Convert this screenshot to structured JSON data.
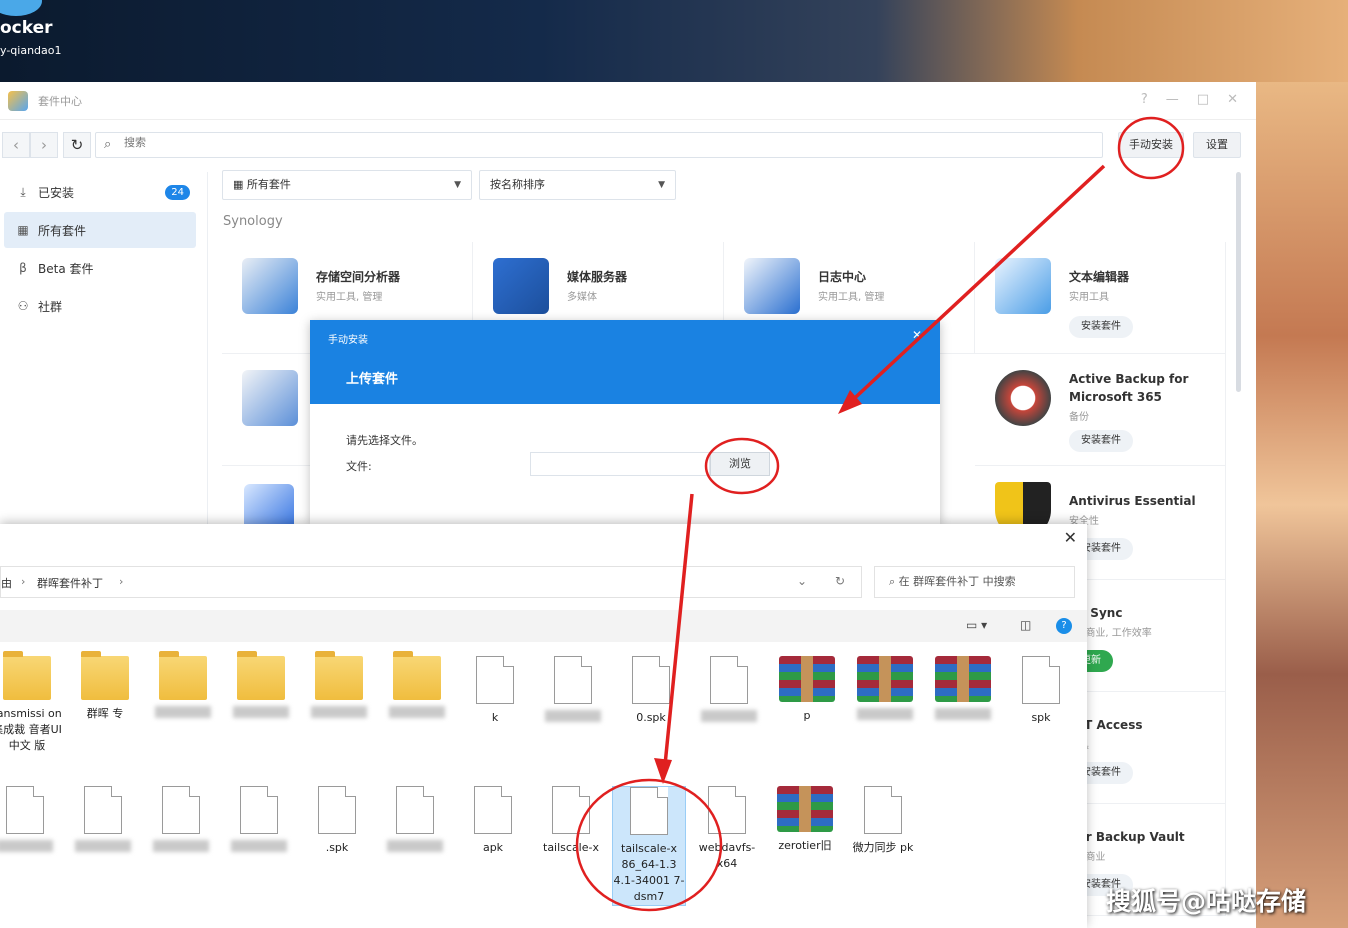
{
  "desktop": {
    "dock_label": "ocker",
    "user": "y-qiandao1"
  },
  "window": {
    "title": "套件中心",
    "controls": [
      "?",
      "—",
      "□",
      "✕"
    ]
  },
  "toolbar": {
    "search_placeholder": "搜索",
    "manual_install": "手动安装",
    "settings": "设置"
  },
  "sidebar": {
    "items": [
      {
        "label": "已安装",
        "icon": "download-icon",
        "badge": "24"
      },
      {
        "label": "所有套件",
        "icon": "grid-icon"
      },
      {
        "label": "Beta 套件",
        "icon": "beta-icon"
      },
      {
        "label": "社群",
        "icon": "community-icon"
      }
    ]
  },
  "filters": {
    "category": "所有套件",
    "sort": "按名称排序"
  },
  "section": "Synology",
  "cards": [
    {
      "name": "存储空间分析器",
      "sub": "实用工具, 管理",
      "color": "#3b82d8"
    },
    {
      "name": "媒体服务器",
      "sub": "多媒体",
      "color": "#1c4f9c"
    },
    {
      "name": "日志中心",
      "sub": "实用工具, 管理",
      "color": "#2a6fd0"
    },
    {
      "name": "文本编辑器",
      "sub": "实用工具",
      "button": "安装套件",
      "color": "#4a9de6"
    },
    {
      "name": "Active Backup for Microsoft 365",
      "sub": "备份",
      "button": "安装套件",
      "color": "#c7453a"
    },
    {
      "name": "Antivirus Essential",
      "sub": "安全性",
      "button": "安装套件",
      "color": "#f0c419"
    },
    {
      "name": "ud Sync",
      "sub": "业, 商业, 工作效率",
      "button": "更新",
      "color": "#2fa84f"
    },
    {
      "name": "FAT Access",
      "sub": "工具",
      "button": "安装套件",
      "color": "#888888"
    },
    {
      "name": "per Backup Vault",
      "sub": "业, 商业",
      "button": "安装套件",
      "color": "#888888"
    }
  ],
  "dialog": {
    "title": "手动安装",
    "step": "上传套件",
    "hint": "请先选择文件。",
    "file_label": "文件:",
    "browse": "浏览",
    "close": "✕"
  },
  "explorer": {
    "crumbs": [
      "由",
      "群晖套件补丁"
    ],
    "search_placeholder": "在 群晖套件补丁 中搜索",
    "close": "✕",
    "row1": [
      {
        "type": "folder",
        "label": "ransmissi on集成裁 音者UI中文 版"
      },
      {
        "type": "folder",
        "label": "群晖 专"
      },
      {
        "type": "folder",
        "label": ""
      },
      {
        "type": "folder",
        "label": ""
      },
      {
        "type": "folder",
        "label": ""
      },
      {
        "type": "folder",
        "label": ""
      },
      {
        "type": "doc",
        "label": "k"
      },
      {
        "type": "doc",
        "label": ""
      },
      {
        "type": "doc",
        "label": "0.spk"
      },
      {
        "type": "doc",
        "label": ""
      },
      {
        "type": "rar",
        "label": "p"
      },
      {
        "type": "rar",
        "label": ""
      },
      {
        "type": "rar",
        "label": ""
      },
      {
        "type": "doc",
        "label": "spk"
      }
    ],
    "row2": [
      {
        "type": "doc",
        "label": ""
      },
      {
        "type": "doc",
        "label": ""
      },
      {
        "type": "doc",
        "label": ""
      },
      {
        "type": "doc",
        "label": ""
      },
      {
        "type": "doc",
        "label": ".spk"
      },
      {
        "type": "doc",
        "label": ""
      },
      {
        "type": "doc",
        "label": "apk"
      },
      {
        "type": "doc",
        "label": "tailscale-x"
      },
      {
        "type": "doc",
        "label": "tailscale-x 86_64-1.3 4.1-34001 7-dsm7",
        "selected": true
      },
      {
        "type": "doc",
        "label": "webdavfs- x64"
      },
      {
        "type": "rar",
        "label": "zerotier旧"
      },
      {
        "type": "doc",
        "label": "微力同步 pk"
      }
    ]
  },
  "watermark": "搜狐号@咕哒存储",
  "accent": "#1a82e2",
  "annotation_color": "#e02020"
}
